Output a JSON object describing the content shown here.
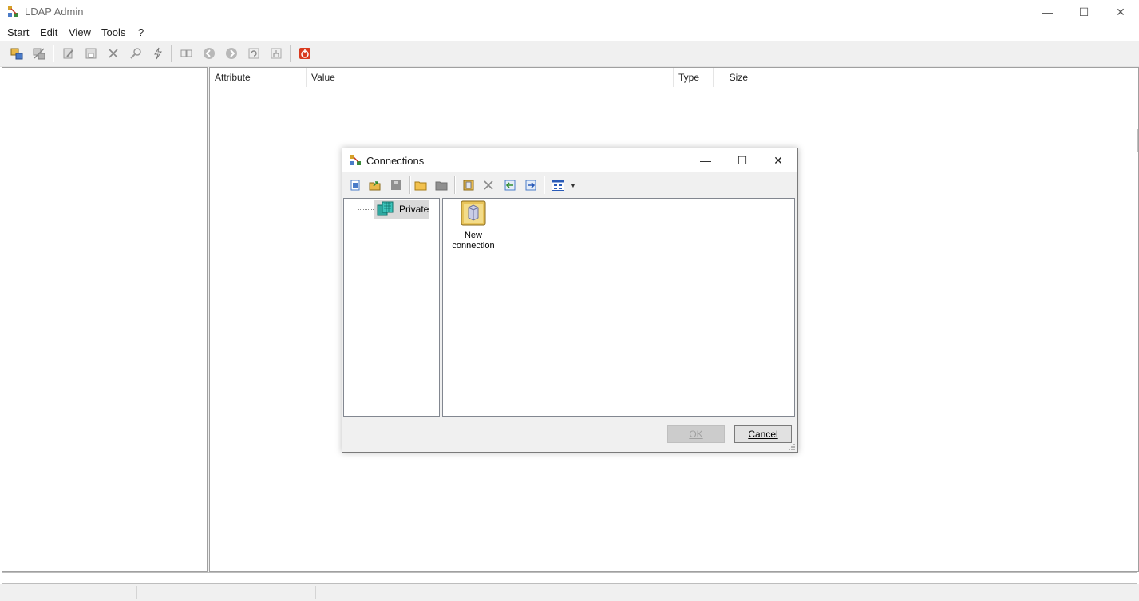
{
  "window": {
    "title": "LDAP Admin",
    "minimize": "—",
    "maximize": "☐",
    "close": "✕"
  },
  "menu": [
    {
      "label": "Start"
    },
    {
      "label": "Edit"
    },
    {
      "label": "View"
    },
    {
      "label": "Tools"
    },
    {
      "label": "?"
    }
  ],
  "columns": {
    "attribute": "Attribute",
    "value": "Value",
    "type": "Type",
    "size": "Size"
  },
  "dialog": {
    "title": "Connections",
    "minimize": "—",
    "maximize": "☐",
    "close": "✕",
    "tree": {
      "root_label": "Private"
    },
    "list": {
      "item_line1": "New",
      "item_line2": "connection"
    },
    "ok_label": "OK",
    "cancel_label": "Cancel"
  },
  "colors": {
    "accent_orange": "#d35400",
    "disabled_gray": "#a0a0a0",
    "folder_yellow": "#e8b84a"
  }
}
